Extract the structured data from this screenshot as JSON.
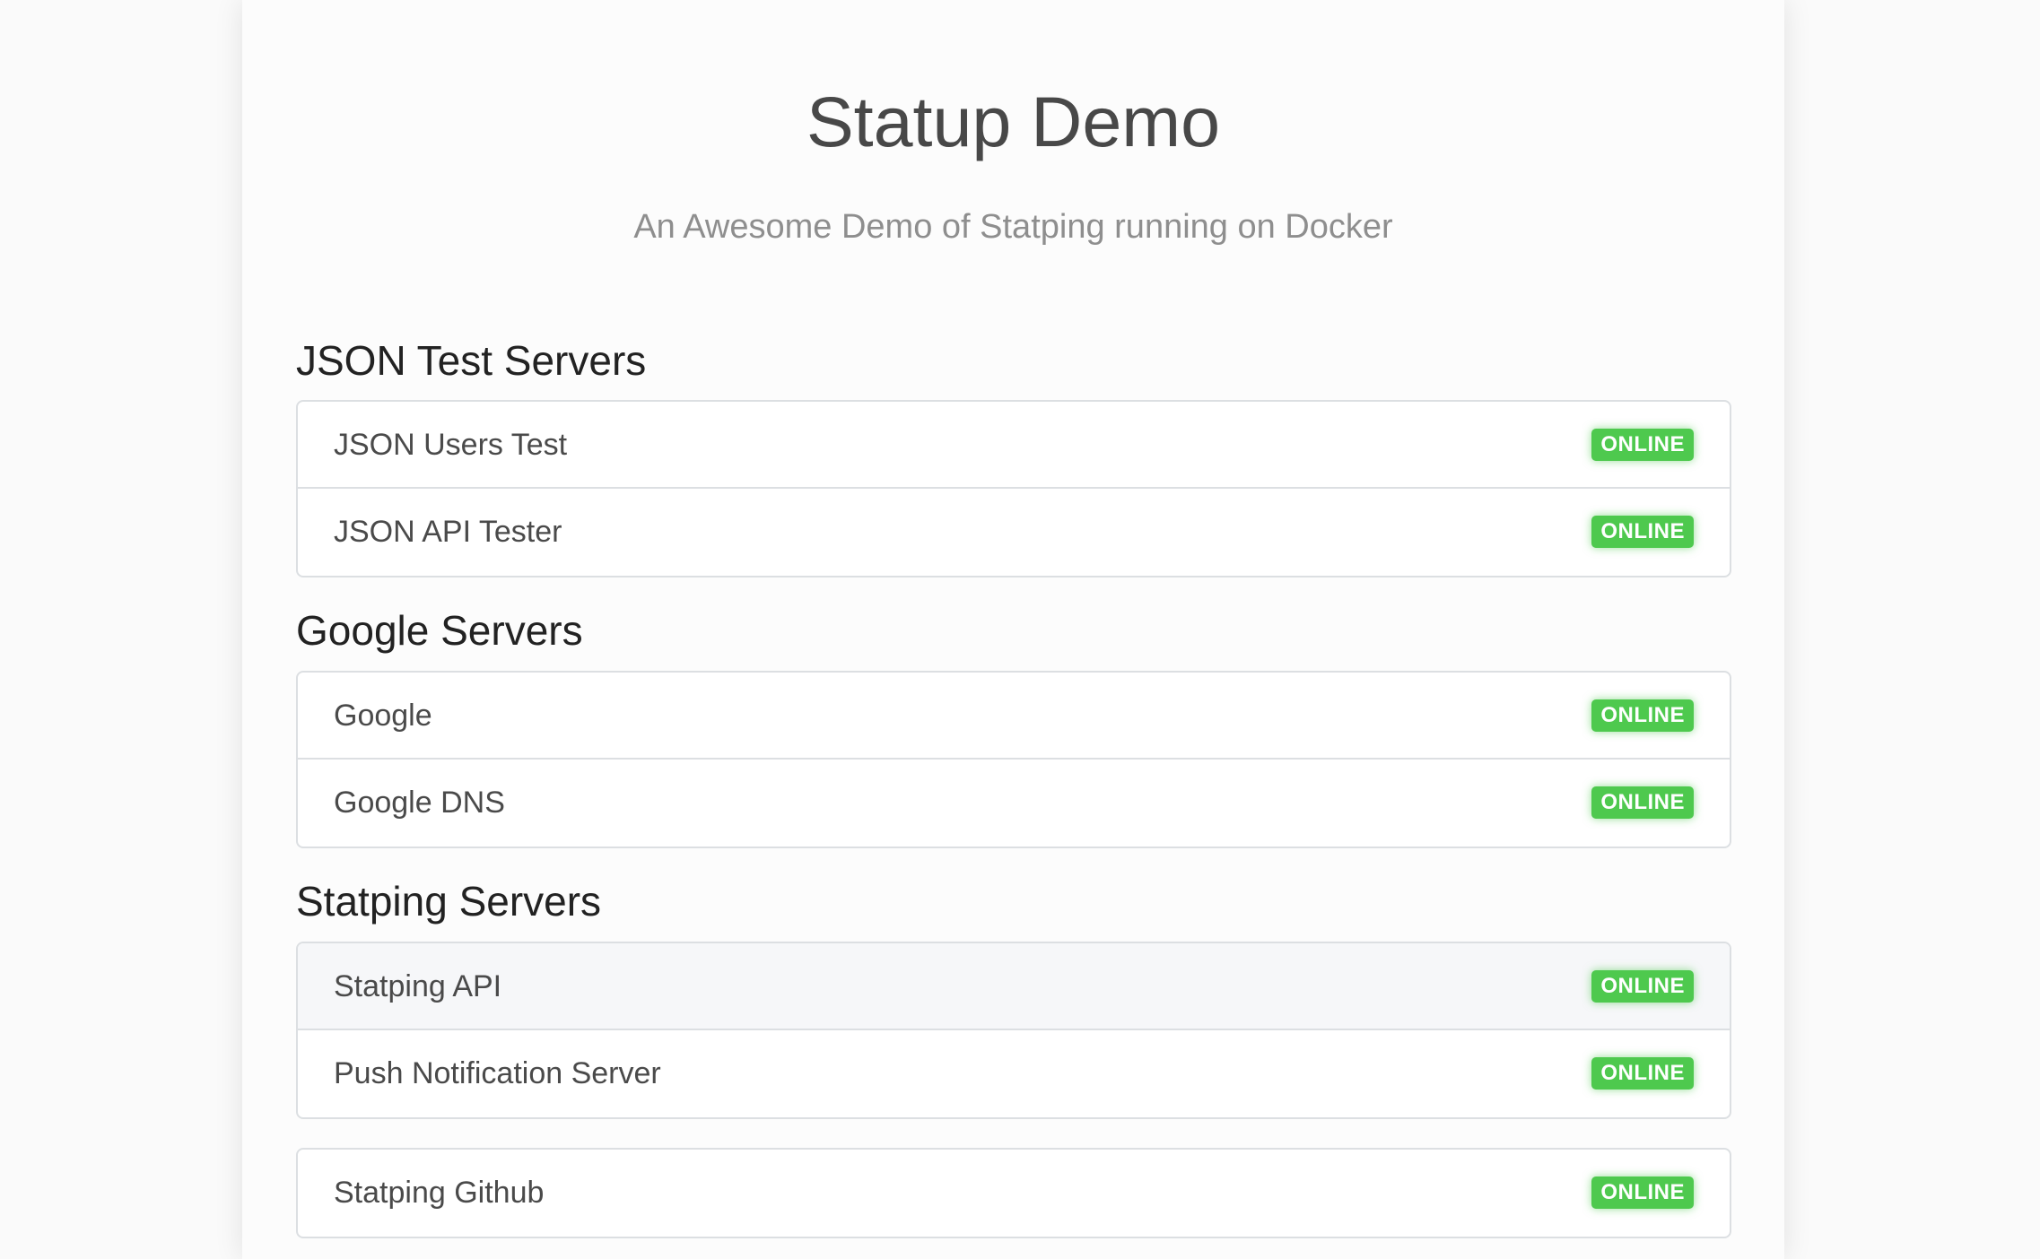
{
  "header": {
    "title": "Statup Demo",
    "subtitle": "An Awesome Demo of Statping running on Docker"
  },
  "colors": {
    "online": "#4ec94e"
  },
  "groups": [
    {
      "title": "JSON Test Servers",
      "services": [
        {
          "name": "JSON Users Test",
          "status": "ONLINE"
        },
        {
          "name": "JSON API Tester",
          "status": "ONLINE"
        }
      ]
    },
    {
      "title": "Google Servers",
      "services": [
        {
          "name": "Google",
          "status": "ONLINE"
        },
        {
          "name": "Google DNS",
          "status": "ONLINE"
        }
      ]
    },
    {
      "title": "Statping Servers",
      "services": [
        {
          "name": "Statping API",
          "status": "ONLINE"
        },
        {
          "name": "Push Notification Server",
          "status": "ONLINE"
        }
      ]
    },
    {
      "title": "",
      "services": [
        {
          "name": "Statping Github",
          "status": "ONLINE"
        }
      ]
    }
  ]
}
